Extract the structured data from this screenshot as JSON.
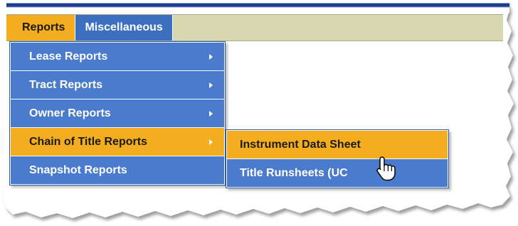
{
  "menubar": {
    "items": [
      {
        "label": "Reports",
        "active": true
      },
      {
        "label": "Miscellaneous",
        "active": false
      }
    ]
  },
  "reports_menu": {
    "items": [
      {
        "label": "Lease Reports",
        "has_submenu": true
      },
      {
        "label": "Tract Reports",
        "has_submenu": true
      },
      {
        "label": "Owner Reports",
        "has_submenu": true
      },
      {
        "label": "Chain of Title Reports",
        "has_submenu": true,
        "active": true
      },
      {
        "label": "Snapshot Reports",
        "has_submenu": false
      }
    ]
  },
  "chain_of_title_submenu": {
    "items": [
      {
        "label": "Instrument Data Sheet",
        "active": true
      },
      {
        "label": "Title Runsheets (UC",
        "active": false
      }
    ]
  },
  "colors": {
    "menu_blue": "#4a7bcc",
    "highlight_orange": "#f4ad1e",
    "menubar_bg": "#d8d8b0",
    "top_stripe": "#1a3d8f"
  },
  "cursor": "hand-pointer-icon"
}
